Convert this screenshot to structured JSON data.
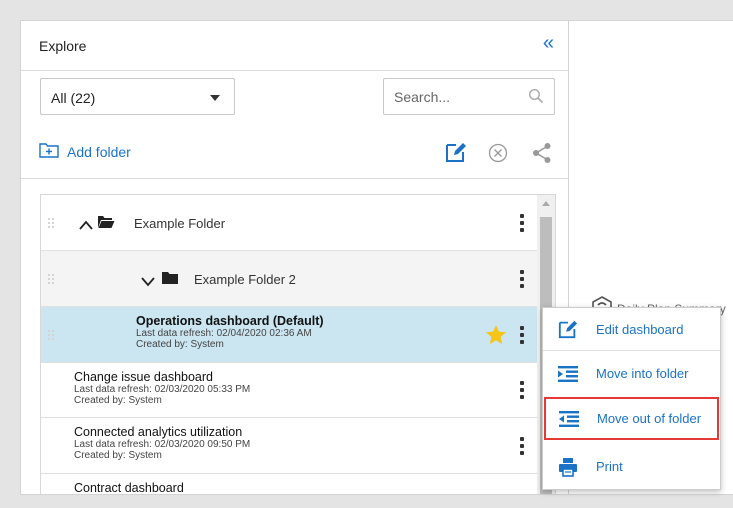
{
  "panel": {
    "title": "Explore",
    "collapse_icon": "double-chevron-left-icon"
  },
  "filter": {
    "selected": "All (22)"
  },
  "search": {
    "placeholder": "Search..."
  },
  "toolbar": {
    "add_folder_label": "Add folder"
  },
  "tree": {
    "folders": [
      {
        "name": "Example Folder",
        "expanded": true
      },
      {
        "name": "Example Folder 2",
        "expanded": true
      }
    ],
    "dashboards": [
      {
        "title": "Operations dashboard (Default)",
        "refresh": "Last data refresh: 02/04/2020 02:36 AM",
        "created": "Created by: System",
        "starred": true,
        "selected": true
      },
      {
        "title": "Change issue dashboard",
        "refresh": "Last data refresh: 02/03/2020 05:33 PM",
        "created": "Created by: System"
      },
      {
        "title": "Connected analytics utilization",
        "refresh": "Last data refresh: 02/03/2020 09:50 PM",
        "created": "Created by: System"
      },
      {
        "title": "Contract dashboard"
      }
    ]
  },
  "canvas": {
    "title": "Daily Plan Summary"
  },
  "context_menu": {
    "items": [
      {
        "label": "Edit dashboard",
        "icon": "edit-icon"
      },
      {
        "label": "Move into folder",
        "icon": "indent-icon"
      },
      {
        "label": "Move out of folder",
        "icon": "outdent-icon",
        "highlighted": true
      },
      {
        "label": "Print",
        "icon": "printer-icon"
      }
    ]
  },
  "colors": {
    "accent": "#1a73c7",
    "selected_row": "#cbe5f1",
    "star": "#f5c518",
    "highlight": "#e53935"
  }
}
